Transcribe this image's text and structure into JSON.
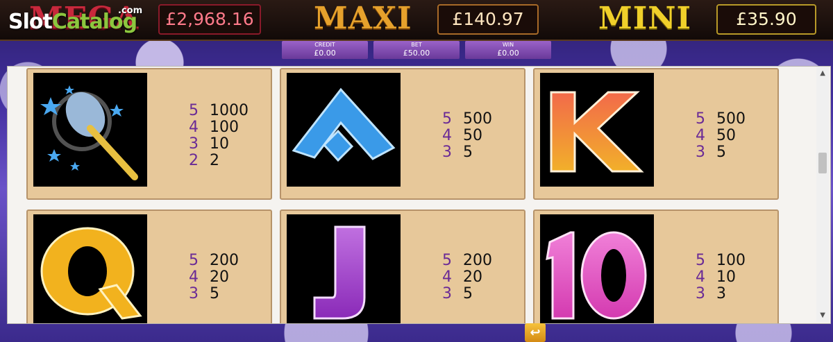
{
  "jackpots": {
    "mega": {
      "label": "MEGA",
      "value": "£2,968.16"
    },
    "maxi": {
      "label": "MAXI",
      "value": "£140.97"
    },
    "mini": {
      "label": "MINI",
      "value": "£35.90"
    }
  },
  "watermark": {
    "slot": "Slot",
    "catalog": "Catalog",
    "com": ".com"
  },
  "stats": {
    "credit": {
      "label": "CREDIT",
      "value": "£0.00"
    },
    "bet": {
      "label": "BET",
      "value": "£50.00"
    },
    "win": {
      "label": "WIN",
      "value": "£0.00"
    }
  },
  "paytable": [
    {
      "symbol": "wand-symbol-icon",
      "pays": [
        {
          "count": "5",
          "amount": "1000"
        },
        {
          "count": "4",
          "amount": "100"
        },
        {
          "count": "3",
          "amount": "10"
        },
        {
          "count": "2",
          "amount": "2"
        }
      ]
    },
    {
      "symbol": "a-symbol-icon",
      "pays": [
        {
          "count": "5",
          "amount": "500"
        },
        {
          "count": "4",
          "amount": "50"
        },
        {
          "count": "3",
          "amount": "5"
        }
      ]
    },
    {
      "symbol": "k-symbol-icon",
      "pays": [
        {
          "count": "5",
          "amount": "500"
        },
        {
          "count": "4",
          "amount": "50"
        },
        {
          "count": "3",
          "amount": "5"
        }
      ]
    },
    {
      "symbol": "q-symbol-icon",
      "pays": [
        {
          "count": "5",
          "amount": "200"
        },
        {
          "count": "4",
          "amount": "20"
        },
        {
          "count": "3",
          "amount": "5"
        }
      ]
    },
    {
      "symbol": "j-symbol-icon",
      "pays": [
        {
          "count": "5",
          "amount": "200"
        },
        {
          "count": "4",
          "amount": "20"
        },
        {
          "count": "3",
          "amount": "5"
        }
      ]
    },
    {
      "symbol": "ten-symbol-icon",
      "pays": [
        {
          "count": "5",
          "amount": "100"
        },
        {
          "count": "4",
          "amount": "10"
        },
        {
          "count": "3",
          "amount": "3"
        }
      ]
    }
  ],
  "colors": {
    "mega": "#c8283c",
    "maxi": "#e6a12c",
    "mini": "#f0d02a",
    "count": "#6a2a96",
    "cell_bg": "#e7c89a"
  },
  "icons": {
    "back": "back-arrow-icon",
    "scroll_up": "scroll-up-icon",
    "scroll_down": "scroll-down-icon"
  }
}
